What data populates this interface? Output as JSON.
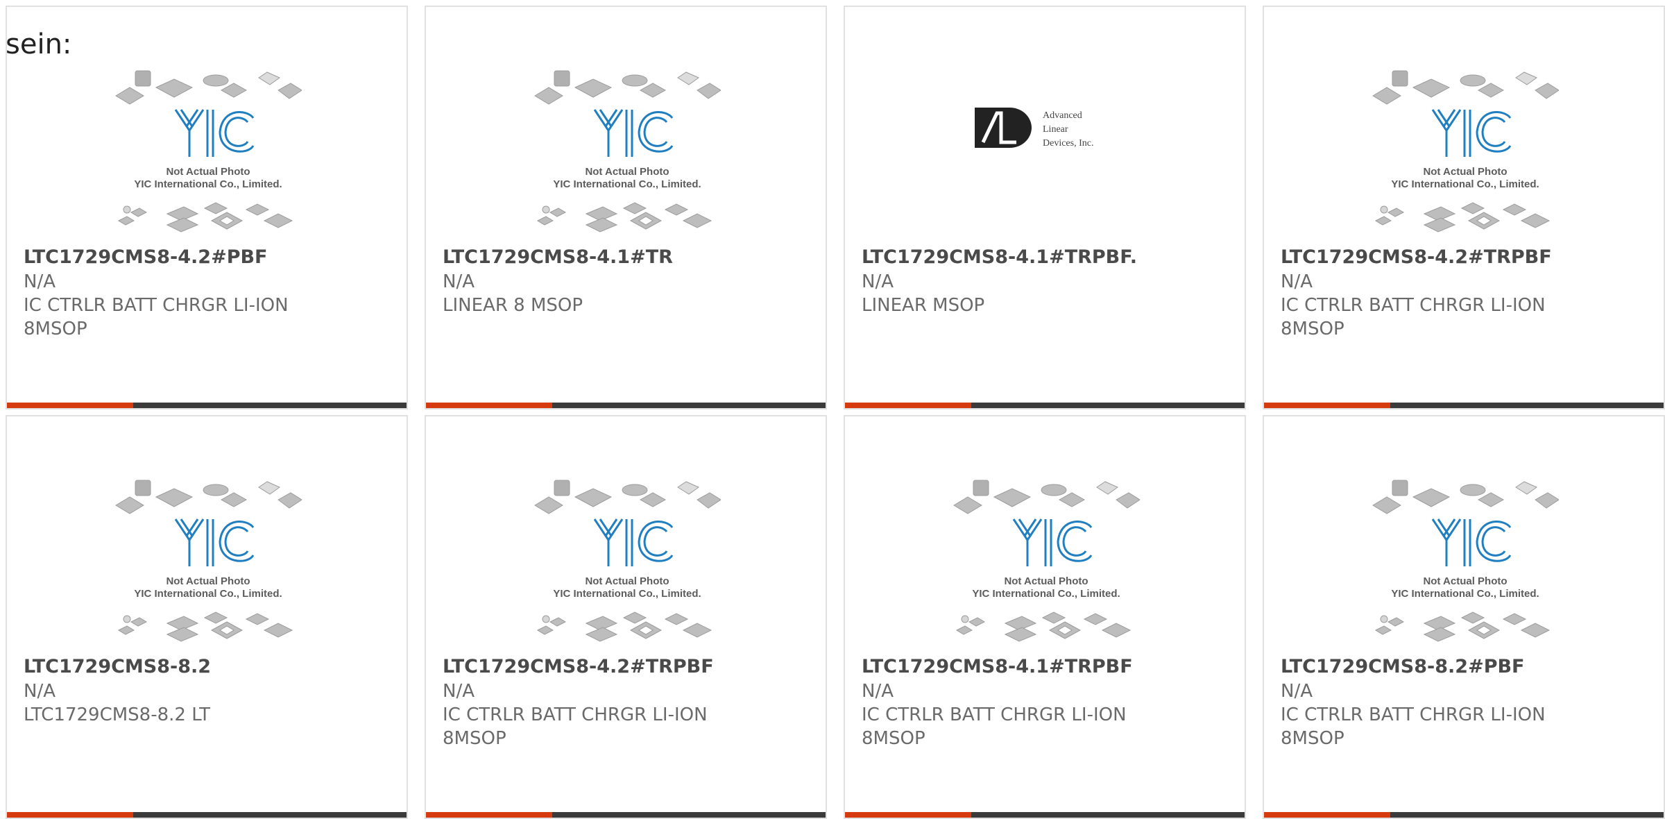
{
  "intro_text": "sein:",
  "placeholder": {
    "line1": "Not Actual Photo",
    "line2": "YIC International Co., Limited."
  },
  "ald_logo": {
    "line1": "Advanced",
    "line2": "Linear",
    "line3": "Devices, Inc."
  },
  "colors": {
    "accent": "#d63a0f",
    "bar": "#3b3b3b",
    "yic_blue": "#1f7fc1",
    "border": "#e1e1e1"
  },
  "products": [
    {
      "part_number": "LTC1729CMS8-4.2#PBF",
      "manufacturer": "N/A",
      "description": "IC CTRLR BATT CHRGR LI-ION 8MSOP",
      "image": "yic-placeholder"
    },
    {
      "part_number": "LTC1729CMS8-4.1#TR",
      "manufacturer": "N/A",
      "description": "LINEAR 8 MSOP",
      "image": "yic-placeholder"
    },
    {
      "part_number": "LTC1729CMS8-4.1#TRPBF.",
      "manufacturer": "N/A",
      "description": "LINEAR MSOP",
      "image": "ald-logo"
    },
    {
      "part_number": "LTC1729CMS8-4.2#TRPBF",
      "manufacturer": "N/A",
      "description": "IC CTRLR BATT CHRGR LI-ION 8MSOP",
      "image": "yic-placeholder"
    },
    {
      "part_number": "LTC1729CMS8-8.2",
      "manufacturer": "N/A",
      "description": "LTC1729CMS8-8.2 LT",
      "image": "yic-placeholder"
    },
    {
      "part_number": "LTC1729CMS8-4.2#TRPBF",
      "manufacturer": "N/A",
      "description": "IC CTRLR BATT CHRGR LI-ION 8MSOP",
      "image": "yic-placeholder"
    },
    {
      "part_number": "LTC1729CMS8-4.1#TRPBF",
      "manufacturer": "N/A",
      "description": "IC CTRLR BATT CHRGR LI-ION 8MSOP",
      "image": "yic-placeholder"
    },
    {
      "part_number": "LTC1729CMS8-8.2#PBF",
      "manufacturer": "N/A",
      "description": "IC CTRLR BATT CHRGR LI-ION 8MSOP",
      "image": "yic-placeholder"
    }
  ]
}
